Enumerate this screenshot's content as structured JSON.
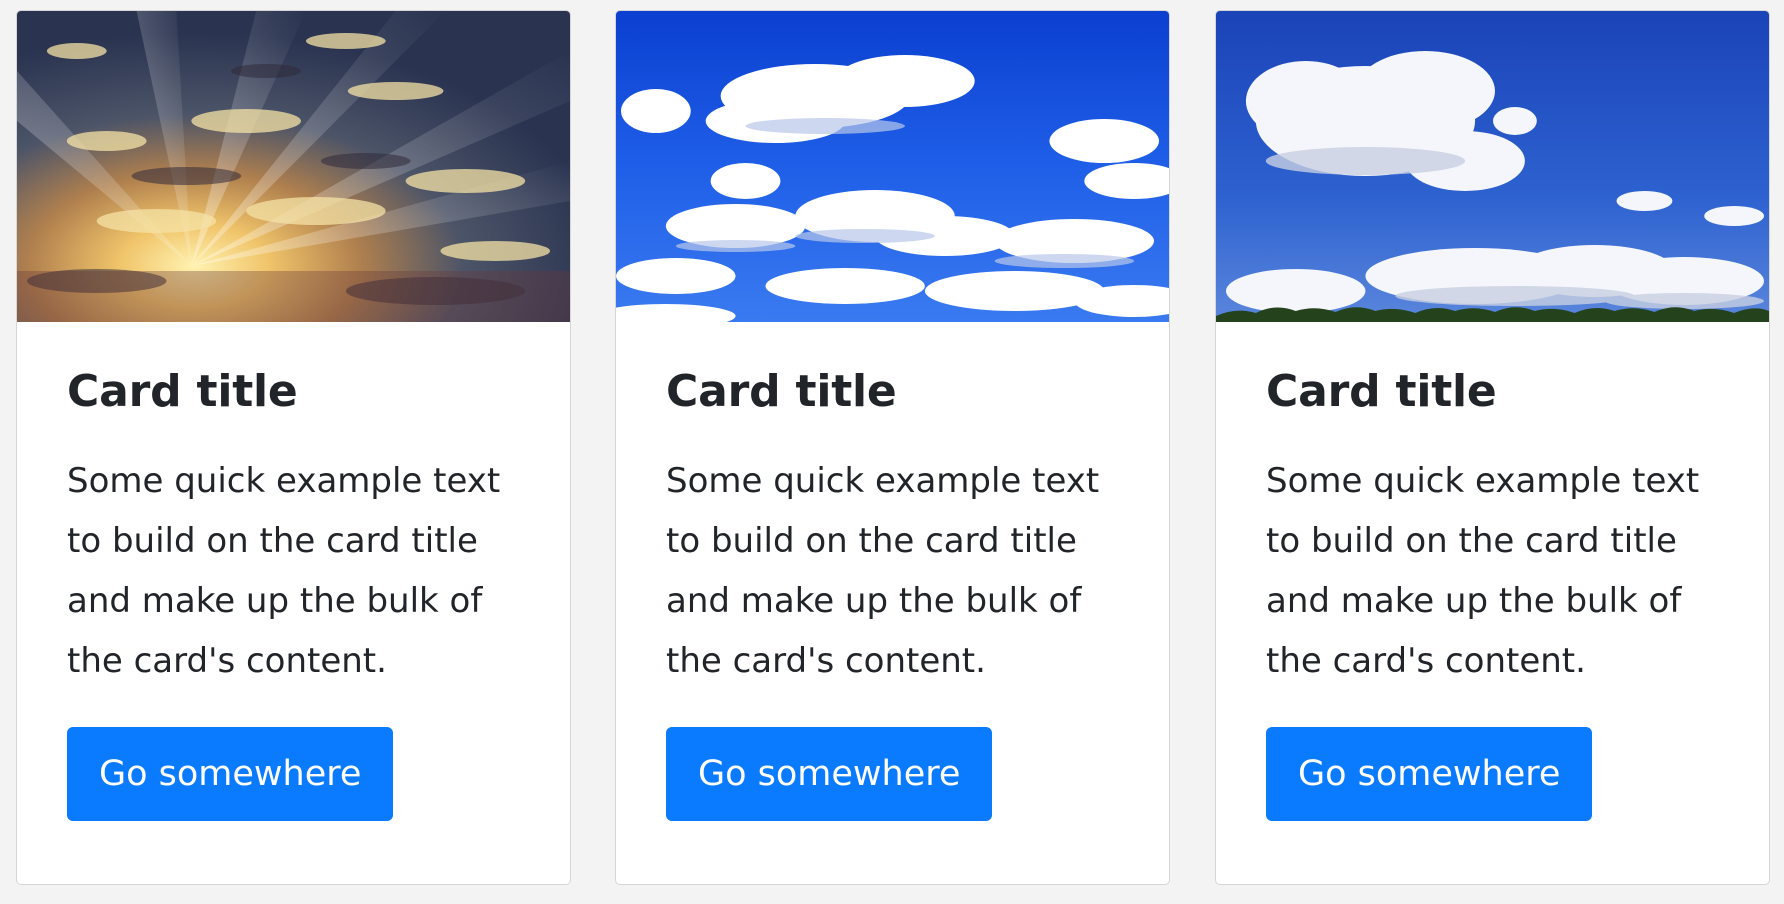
{
  "cards": [
    {
      "image_icon": "sunset-clouds-image",
      "title": "Card title",
      "text": "Some quick example text to build on the card title and make up the bulk of the card's content.",
      "button_label": "Go somewhere"
    },
    {
      "image_icon": "blue-sky-clouds-image",
      "title": "Card title",
      "text": "Some quick example text to build on the card title and make up the bulk of the card's content.",
      "button_label": "Go somewhere"
    },
    {
      "image_icon": "sky-clouds-treeline-image",
      "title": "Card title",
      "text": "Some quick example text to build on the card title and make up the bulk of the card's content.",
      "button_label": "Go somewhere"
    }
  ],
  "colors": {
    "page_background": "#f3f3f3",
    "button_primary": "#0a7bff",
    "text_dark": "#212529"
  }
}
